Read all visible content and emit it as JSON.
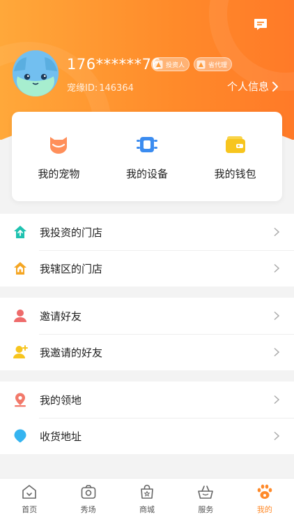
{
  "header": {
    "phone": "176******76",
    "badges": [
      "投资人",
      "省代理"
    ],
    "uid_label": "宠缘ID:",
    "uid_value": "146364",
    "profile_link": "个人信息"
  },
  "quick_actions": [
    {
      "label": "我的宠物",
      "icon": "pet-icon"
    },
    {
      "label": "我的设备",
      "icon": "device-icon"
    },
    {
      "label": "我的钱包",
      "icon": "wallet-icon"
    }
  ],
  "groups": [
    [
      {
        "label": "我投资的门店",
        "icon": "home-invest-icon"
      },
      {
        "label": "我辖区的门店",
        "icon": "home-district-icon"
      }
    ],
    [
      {
        "label": "邀请好友",
        "icon": "person-icon"
      },
      {
        "label": "我邀请的好友",
        "icon": "person-add-icon"
      }
    ],
    [
      {
        "label": "我的领地",
        "icon": "location-pin-icon"
      },
      {
        "label": "收货地址",
        "icon": "address-icon"
      }
    ]
  ],
  "tabs": [
    {
      "label": "首页",
      "icon": "home-icon"
    },
    {
      "label": "秀场",
      "icon": "show-icon"
    },
    {
      "label": "商城",
      "icon": "shop-bag-icon"
    },
    {
      "label": "服务",
      "icon": "service-basket-icon"
    },
    {
      "label": "我的",
      "icon": "paw-icon",
      "active": true
    }
  ],
  "colors": {
    "accent": "#ff8a2a",
    "header_start": "#ffa83a",
    "header_end": "#ff7a28",
    "teal": "#1fc2b0",
    "orange": "#f5a623",
    "red": "#ee6b6b",
    "yellow": "#f7c51e",
    "blue": "#35b4f0",
    "coral": "#f2796a"
  }
}
